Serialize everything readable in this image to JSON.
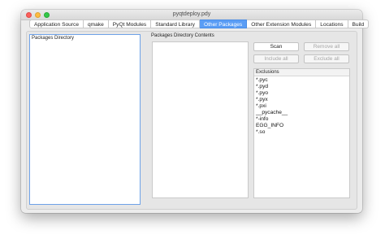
{
  "window": {
    "title": "pyqtdeploy.pdy"
  },
  "tabs": [
    {
      "label": "Application Source",
      "active": false
    },
    {
      "label": "qmake",
      "active": false
    },
    {
      "label": "PyQt Modules",
      "active": false
    },
    {
      "label": "Standard Library",
      "active": false
    },
    {
      "label": "Other Packages",
      "active": true
    },
    {
      "label": "Other Extension Modules",
      "active": false
    },
    {
      "label": "Locations",
      "active": false
    },
    {
      "label": "Build",
      "active": false
    }
  ],
  "packages_directory": {
    "label": "Packages Directory"
  },
  "packages_contents": {
    "label": "Packages Directory Contents"
  },
  "buttons": {
    "scan": "Scan",
    "remove_all": "Remove all",
    "include_all": "Include all",
    "exclude_all": "Exclude all"
  },
  "exclusions": {
    "header": "Exclusions",
    "items": [
      "*.pyc",
      "*.pyd",
      "*.pyo",
      "*.pyx",
      "*.pxi",
      "__pycache__",
      "*-info",
      "EGG_INFO",
      "*.so"
    ]
  },
  "colors": {
    "active_tab": "#5a9df5",
    "selection_border": "#6ea2e8",
    "close": "#fc605c",
    "minimize": "#fdbc40",
    "maximize": "#34c84a"
  }
}
